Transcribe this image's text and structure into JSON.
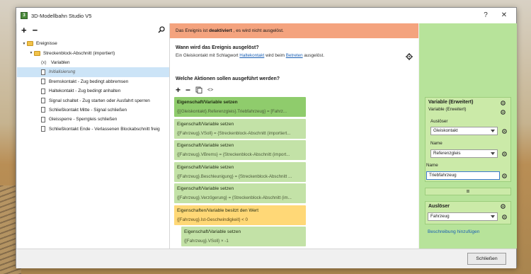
{
  "window": {
    "title": "3D-Modellbahn Studio V5",
    "help_glyph": "?",
    "close_glyph": "✕",
    "app_icon_letter": "3"
  },
  "tree": {
    "add_glyph": "+",
    "remove_glyph": "−",
    "items": [
      {
        "label": "Ereignisse",
        "level": 0,
        "type": "folder",
        "expanded": true
      },
      {
        "label": "Streckenblock-Abschnitt (importiert)",
        "level": 1,
        "type": "folder",
        "expanded": true
      },
      {
        "label": "Variablen",
        "level": 2,
        "type": "variables"
      },
      {
        "label": "Initialisierung",
        "level": 2,
        "type": "doc",
        "selected": true
      },
      {
        "label": "Bremskontakt - Zug bedingt abbremsen",
        "level": 2,
        "type": "doc"
      },
      {
        "label": "Haltekontakt - Zug bedingt anhalten",
        "level": 2,
        "type": "doc"
      },
      {
        "label": "Signal schaltet - Zug starten oder Ausfahrt sperren",
        "level": 2,
        "type": "doc"
      },
      {
        "label": "Schließkontakt Mitte - Signal schließen",
        "level": 2,
        "type": "doc"
      },
      {
        "label": "Gleissperre - Sperrgleis schließen",
        "level": 2,
        "type": "doc"
      },
      {
        "label": "Schließkontakt Ende - Verlassenen Blockabschnitt freig",
        "level": 2,
        "type": "doc"
      }
    ],
    "variables_glyph": "(x)"
  },
  "banner": {
    "prefix": "Das Ereignis ist",
    "status": "deaktiviert",
    "suffix": ", es wird nicht ausgelöst."
  },
  "trigger": {
    "heading": "Wann wird das Ereignis ausgelöst?",
    "text_before": "Ein Gleiskontakt mit Schlagwort",
    "link1": "Haltekontakt",
    "text_middle": "wird beim",
    "link2": "Betreten",
    "text_after": "ausgelöst."
  },
  "actions": {
    "heading": "Welche Aktionen sollen ausgeführt werden?",
    "add_glyph": "+",
    "remove_glyph": "−",
    "code_glyph": "<>",
    "cards": [
      {
        "title": "Eigenschaft/Variable setzen",
        "detail": "{[{Gleiskontakt}.Referenzgleis}.Triebfahrzeug} = [Fahrz...",
        "style": "green first",
        "indent": 0
      },
      {
        "title": "Eigenschaft/Variable setzen",
        "detail": "{[Fahrzeug}.VSoll} = {Streckenblock-Abschnitt (importiert...",
        "style": "green",
        "indent": 0
      },
      {
        "title": "Eigenschaft/Variable setzen",
        "detail": "{[Fahrzeug}.VBrems} = {Streckenblock-Abschnitt (import...",
        "style": "green",
        "indent": 0
      },
      {
        "title": "Eigenschaft/Variable setzen",
        "detail": "{[Fahrzeug}.Beschleunigung} = {Streckenblock-Abschnitt ...",
        "style": "green",
        "indent": 0
      },
      {
        "title": "Eigenschaft/Variable setzen",
        "detail": "{[Fahrzeug}.Verzögerung} = {Streckenblock-Abschnitt (im...",
        "style": "green",
        "indent": 0
      },
      {
        "title": "Eigenschaften/Variable besitzt den Wert",
        "detail": "{[Fahrzeug}.Ist-Geschwindigkeit} < 0",
        "style": "yellow",
        "indent": 0
      },
      {
        "title": "Eigenschaft/Variable setzen",
        "detail": "{[Fahrzeug}.VSoll} × -1",
        "style": "green",
        "indent": 1
      },
      {
        "title": "Eigenschaft/Variable setzen",
        "detail": "",
        "style": "green",
        "indent": 1
      }
    ]
  },
  "variable_panel": {
    "heading": "Variable (Erweitert)",
    "sublabel": "Variable (Erweitert)",
    "trigger_label": "Auslöser",
    "trigger_value": "Gleiskontakt",
    "name_label": "Name",
    "name_value": "Referenzgleis",
    "name2_label": "Name",
    "name2_value": "Triebfahrzeug",
    "equals_glyph": "="
  },
  "trigger_panel": {
    "heading": "Auslöser",
    "value": "Fahrzeug"
  },
  "add_description": "Beschreibung hinzufügen",
  "close_button": "Schließen",
  "colors": {
    "banner_warning": "#f4a37e",
    "action_green": "#c3e2a7",
    "action_green_first": "#8fcc6c",
    "condition_yellow": "#ffd877",
    "right_panel": "#b7e39a",
    "link": "#1a5fb4"
  }
}
